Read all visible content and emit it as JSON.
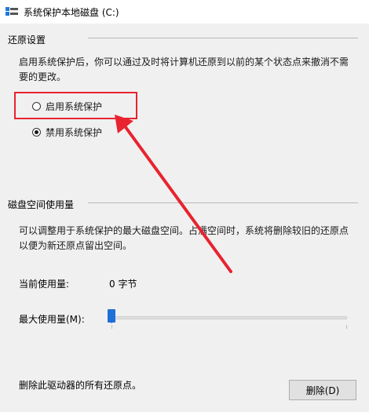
{
  "window": {
    "title": "系统保护本地磁盘 (C:)"
  },
  "restore_settings": {
    "heading": "还原设置",
    "description_line1": "启用系统保护后，你可以通过及时将计算机还原到以前的某个状态点来撤消不需",
    "description_line2": "要的更改。",
    "options": [
      {
        "label": "启用系统保护",
        "selected": false
      },
      {
        "label": "禁用系统保护",
        "selected": true
      }
    ]
  },
  "disk_usage": {
    "heading": "磁盘空间使用量",
    "description_line1": "可以调整用于系统保护的最大磁盘空间。占满空间时，系统将删除较旧的还原点",
    "description_line2": "以便为新还原点留出空间。",
    "current_label": "当前使用量:",
    "current_value": "0 字节",
    "max_label": "最大使用量(M):",
    "slider_fraction": 0
  },
  "delete": {
    "text": "删除此驱动器的所有还原点。",
    "button_label": "删除(D)"
  },
  "colors": {
    "annotation": "#e8232f",
    "slider_accent": "#1f6fd6"
  }
}
